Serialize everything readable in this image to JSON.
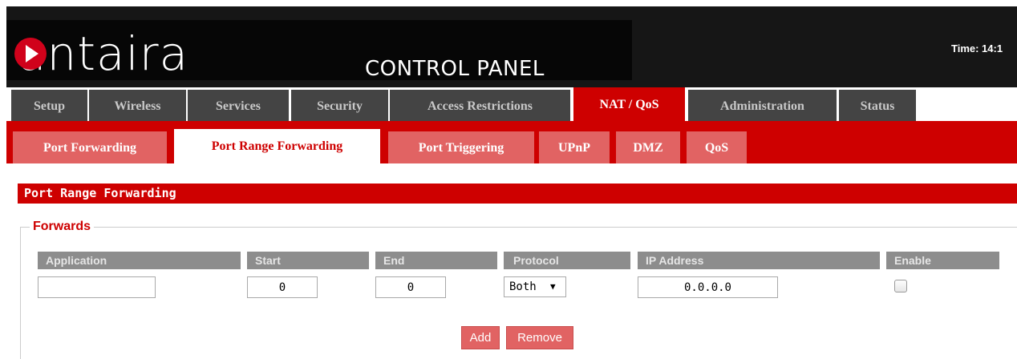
{
  "header": {
    "logo_text": "antaira",
    "title": "CONTROL PANEL",
    "time_label": "Time: 14:1"
  },
  "top_tabs": [
    {
      "label": "Setup"
    },
    {
      "label": "Wireless"
    },
    {
      "label": "Services"
    },
    {
      "label": "Security"
    },
    {
      "label": "Access Restrictions"
    },
    {
      "label": "NAT / QoS",
      "active": true
    },
    {
      "label": "Administration"
    },
    {
      "label": "Status"
    }
  ],
  "sub_tabs": [
    {
      "label": "Port Forwarding"
    },
    {
      "label": "Port Range Forwarding",
      "active": true
    },
    {
      "label": "Port Triggering"
    },
    {
      "label": "UPnP"
    },
    {
      "label": "DMZ"
    },
    {
      "label": "QoS"
    }
  ],
  "section": {
    "title": "Port Range Forwarding",
    "legend": "Forwards"
  },
  "table": {
    "headers": {
      "application": "Application",
      "start": "Start",
      "end": "End",
      "protocol": "Protocol",
      "ip_address": "IP Address",
      "enable": "Enable"
    },
    "row": {
      "application": "",
      "start": "0",
      "end": "0",
      "protocol": "Both",
      "ip_address": "0.0.0.0",
      "enabled": false
    }
  },
  "buttons": {
    "add": "Add",
    "remove": "Remove"
  },
  "colors": {
    "accent": "#ce0000",
    "tab_inactive": "#444444",
    "subtab_inactive": "#e16363"
  },
  "icons": {
    "logo": "play-circle-icon",
    "dropdown": "triangle-down-icon"
  }
}
